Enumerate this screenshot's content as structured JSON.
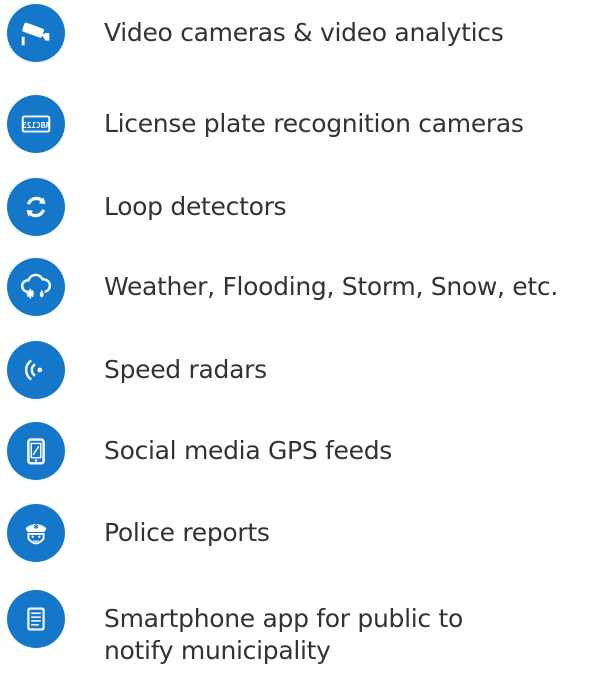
{
  "accent": "#1577c9",
  "text_color": "#333333",
  "items": [
    {
      "icon": "security-camera-icon",
      "label": "Video cameras & video analytics"
    },
    {
      "icon": "license-plate-icon",
      "label": "License plate recognition cameras",
      "plate_text": "ABC123"
    },
    {
      "icon": "loop-arrows-icon",
      "label": "Loop detectors"
    },
    {
      "icon": "weather-storm-icon",
      "label": "Weather, Flooding, Storm, Snow, etc."
    },
    {
      "icon": "radar-signal-icon",
      "label": "Speed radars"
    },
    {
      "icon": "smartphone-icon",
      "label": "Social media GPS feeds"
    },
    {
      "icon": "police-officer-icon",
      "label": "Police reports"
    },
    {
      "icon": "document-icon",
      "label_line1": "Smartphone app for public to",
      "label_line2": "notify municipality"
    }
  ]
}
